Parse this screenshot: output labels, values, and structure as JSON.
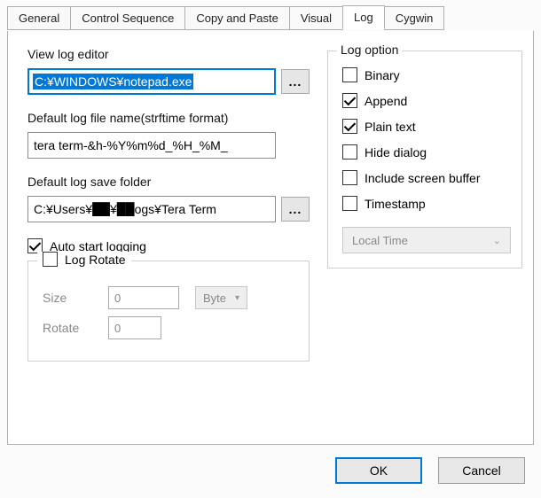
{
  "tabs": {
    "general": "General",
    "control_sequence": "Control Sequence",
    "copy_paste": "Copy and Paste",
    "visual": "Visual",
    "log": "Log",
    "cygwin": "Cygwin"
  },
  "left": {
    "view_log_editor_label": "View log editor",
    "view_log_editor_value": "C:¥WINDOWS¥notepad.exe",
    "browse_glyph": "...",
    "default_log_file_name_label": "Default log file name(strftime format)",
    "default_log_file_name_value": "tera term-&h-%Y%m%d_%H_%M_",
    "default_log_save_folder_label": "Default log save folder",
    "default_log_save_folder_value": "C:¥Users¥██¥██ogs¥Tera Term",
    "auto_start_logging_label": "Auto start logging",
    "auto_start_logging_checked": true
  },
  "log_rotate": {
    "legend": "Log Rotate",
    "enabled": false,
    "size_label": "Size",
    "size_value": "0",
    "size_unit": "Byte",
    "rotate_label": "Rotate",
    "rotate_value": "0"
  },
  "right": {
    "legend": "Log option",
    "options": {
      "binary": {
        "label": "Binary",
        "checked": false
      },
      "append": {
        "label": "Append",
        "checked": true
      },
      "plain": {
        "label": "Plain text",
        "checked": true
      },
      "hide": {
        "label": "Hide dialog",
        "checked": false
      },
      "buffer": {
        "label": "Include screen buffer",
        "checked": false
      },
      "timestamp": {
        "label": "Timestamp",
        "checked": false
      }
    },
    "timestamp_mode": "Local Time"
  },
  "buttons": {
    "ok": "OK",
    "cancel": "Cancel"
  }
}
